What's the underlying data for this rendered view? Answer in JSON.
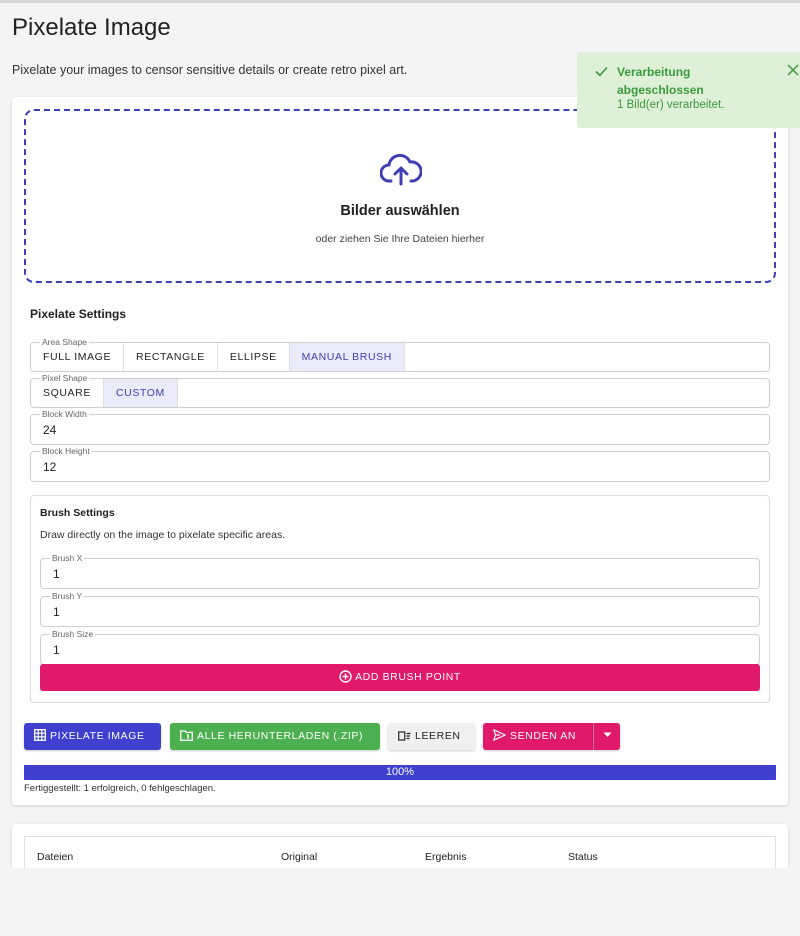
{
  "page": {
    "title": "Pixelate Image",
    "description": "Pixelate your images to censor sensitive details or create retro pixel art."
  },
  "dropzone": {
    "title": "Bilder auswählen",
    "subtitle": "oder ziehen Sie Ihre Dateien hierher"
  },
  "settings": {
    "title": "Pixelate Settings",
    "area_shape": {
      "label": "Area Shape",
      "options": [
        "FULL IMAGE",
        "RECTANGLE",
        "ELLIPSE",
        "MANUAL BRUSH"
      ],
      "selected": "MANUAL BRUSH"
    },
    "pixel_shape": {
      "label": "Pixel Shape",
      "options": [
        "SQUARE",
        "CUSTOM"
      ],
      "selected": "CUSTOM"
    },
    "block_width": {
      "label": "Block Width",
      "value": "24"
    },
    "block_height": {
      "label": "Block Height",
      "value": "12"
    }
  },
  "brush": {
    "title": "Brush Settings",
    "description": "Draw directly on the image to pixelate specific areas.",
    "x": {
      "label": "Brush X",
      "value": "1"
    },
    "y": {
      "label": "Brush Y",
      "value": "1"
    },
    "size": {
      "label": "Brush Size",
      "value": "1"
    },
    "add_label": "ADD BRUSH POINT"
  },
  "actions": {
    "pixelate": "PIXELATE IMAGE",
    "download": "ALLE HERUNTERLADEN (.ZIP)",
    "clear": "LEEREN",
    "send": "SENDEN AN"
  },
  "progress": {
    "percent": 100,
    "label": "100%",
    "status": "Fertiggestellt: 1 erfolgreich, 0 fehlgeschlagen."
  },
  "table": {
    "headers": [
      "Dateien",
      "Original",
      "Ergebnis",
      "Status"
    ]
  },
  "toast": {
    "title": "Verarbeitung abgeschlossen",
    "message": "1 Bild(er) verarbeitet."
  },
  "colors": {
    "primary": "#3f3fd0",
    "pink": "#e0196a",
    "green": "#4caf50",
    "toast_bg": "#dff0d8",
    "toast_text": "#3c9a3c"
  },
  "icons": {
    "upload": "cloud-upload-icon",
    "grid": "grid-icon",
    "folder_zip": "folder-zip-icon",
    "clear": "clear-list-icon",
    "send": "send-icon",
    "caret": "caret-down-icon",
    "add": "add-circle-icon",
    "check": "check-icon",
    "close": "close-icon"
  }
}
